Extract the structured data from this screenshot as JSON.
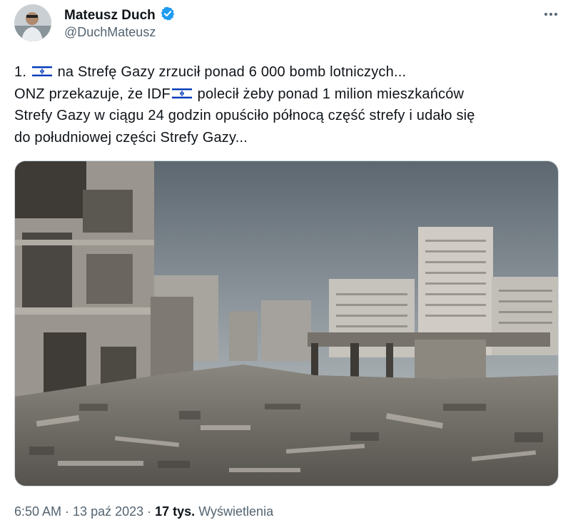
{
  "author": {
    "name": "Mateusz Duch",
    "handle": "@DuchMateusz",
    "verified_icon": "verified-badge-icon",
    "verified_color": "#1d9bf0"
  },
  "more_icon": "more-horizontal-icon",
  "tweet": {
    "line1_a": "1. ",
    "line1_b": " na Strefę Gazy zrzucił ponad 6 000 bomb lotniczych...",
    "line2_a": "ONZ przekazuje, że IDF",
    "line2_b": " polecił żeby ponad 1 milion mieszkańców",
    "line3": "Strefy Gazy w ciągu 24 godzin opuściło północą część strefy i udało się",
    "line4": "do południowej części Strefy Gazy...",
    "flag_icon": "israel-flag-icon"
  },
  "meta": {
    "time": "6:50 AM",
    "sep": " · ",
    "date": "13 paź 2023",
    "views_count": "17 tys.",
    "views_label": "Wyświetlenia"
  },
  "colors": {
    "text": "#0f1419",
    "secondary": "#536471",
    "flag_blue": "#0038b8"
  }
}
